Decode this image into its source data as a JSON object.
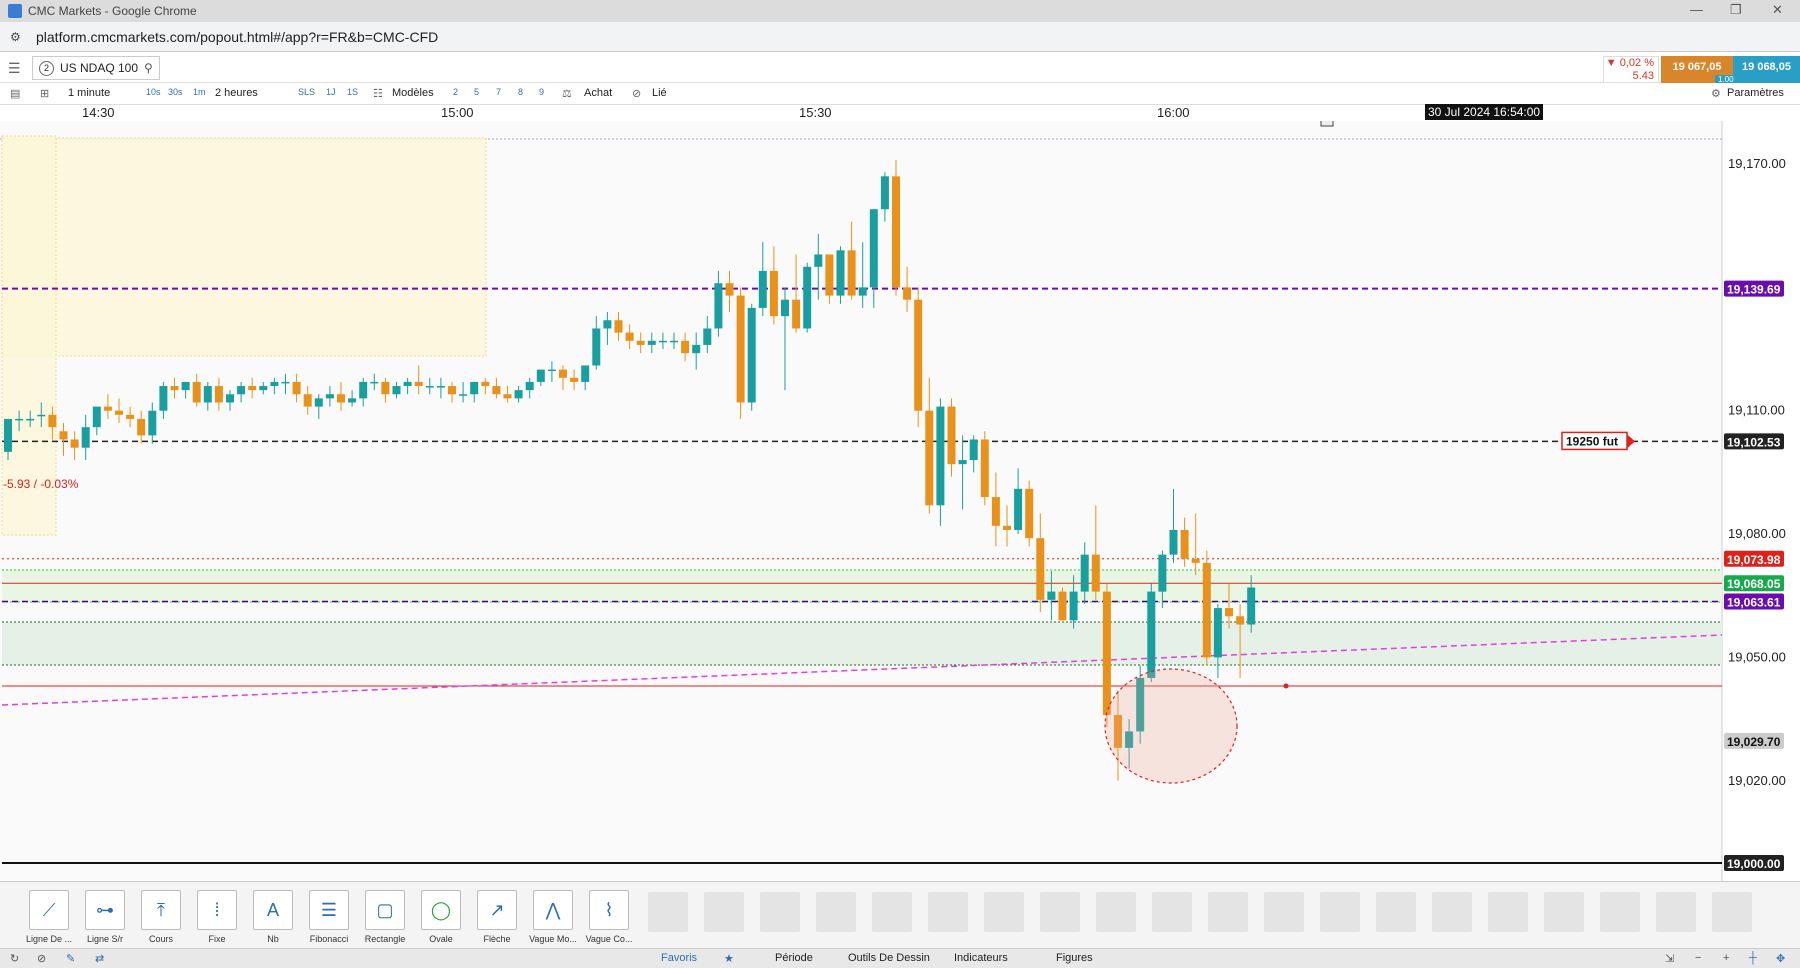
{
  "window": {
    "title": "CMC Markets - Google Chrome"
  },
  "address": {
    "url": "platform.cmcmarkets.com/popout.html#/app?r=FR&b=CMC-CFD"
  },
  "instrument": {
    "index": "2",
    "name": "US NDAQ 100",
    "change_pct": "▼ 0,02 %",
    "change_abs": "5.43",
    "sell_price": "19 067,05",
    "buy_price": "19 068,05",
    "spread": "1.00"
  },
  "toolbar": {
    "interval": "1 minute",
    "interval_options": [
      "10s",
      "30s",
      "1m"
    ],
    "period": "2 heures",
    "period_options": [
      "SLS",
      "1J",
      "1S"
    ],
    "templates": "Modèles",
    "template_slots": [
      "2",
      "5",
      "7",
      "8",
      "9"
    ],
    "buy": "Achat",
    "linked": "Lié",
    "settings": "Paramètres"
  },
  "time_axis": {
    "labels": [
      "14:30",
      "15:00",
      "15:30",
      "16:00"
    ],
    "crosshair": "30 Jul 2024 16:54:00"
  },
  "chart_data": {
    "type": "candlestick",
    "y_ticks": [
      19170,
      19110,
      19080,
      19050,
      19020
    ],
    "y_tick_labels": [
      "19,170.00",
      "19,110.00",
      "19,080.00",
      "19,050.00",
      "19,020.00"
    ],
    "ylim": [
      18994,
      19200
    ],
    "price_labels": [
      {
        "value": 19139.69,
        "text": "19,139.69",
        "color": "#6a0dad"
      },
      {
        "value": 19102.53,
        "text": "19,102.53",
        "color": "#222222"
      },
      {
        "value": 19073.98,
        "text": "19,073.98",
        "color": "#e0201a"
      },
      {
        "value": 19068.05,
        "text": "19,068.05",
        "color": "#1aa84c"
      },
      {
        "value": 19063.61,
        "text": "19,063.61",
        "color": "#6a0dad"
      },
      {
        "value": 19029.7,
        "text": "19,029.70",
        "color": "#cccccc"
      },
      {
        "value": 19000.0,
        "text": "19,000.00",
        "color": "#222222"
      }
    ],
    "alert_label": "19250 fut",
    "change_label": "-5.93 / -0.03%",
    "candles": [
      {
        "o": 19100,
        "h": 19107,
        "c": 19108,
        "l": 19098
      },
      {
        "o": 19108,
        "h": 19110,
        "c": 19108,
        "l": 19105
      },
      {
        "o": 19108,
        "h": 19110,
        "c": 19108,
        "l": 19106
      },
      {
        "o": 19109,
        "h": 19112,
        "c": 19109,
        "l": 19106
      },
      {
        "o": 19109,
        "h": 19111,
        "c": 19106,
        "l": 19103
      },
      {
        "o": 19105,
        "h": 19107,
        "c": 19103,
        "l": 19099
      },
      {
        "o": 19103,
        "h": 19105,
        "c": 19101,
        "l": 19098
      },
      {
        "o": 19101,
        "h": 19109,
        "c": 19106,
        "l": 19098
      },
      {
        "o": 19106,
        "h": 19110,
        "c": 19111,
        "l": 19104
      },
      {
        "o": 19111,
        "h": 19114,
        "c": 19110,
        "l": 19108
      },
      {
        "o": 19110,
        "h": 19113,
        "c": 19109,
        "l": 19107
      },
      {
        "o": 19109,
        "h": 19111,
        "c": 19108,
        "l": 19106
      },
      {
        "o": 19108,
        "h": 19110,
        "c": 19104,
        "l": 19102
      },
      {
        "o": 19104,
        "h": 19112,
        "c": 19110,
        "l": 19102
      },
      {
        "o": 19110,
        "h": 19117,
        "c": 19116,
        "l": 19108
      },
      {
        "o": 19116,
        "h": 19118,
        "c": 19115,
        "l": 19113
      },
      {
        "o": 19115,
        "h": 19117,
        "c": 19117,
        "l": 19113
      },
      {
        "o": 19117,
        "h": 19119,
        "c": 19112,
        "l": 19111
      },
      {
        "o": 19112,
        "h": 19117,
        "c": 19116,
        "l": 19110
      },
      {
        "o": 19116,
        "h": 19118,
        "c": 19112,
        "l": 19110
      },
      {
        "o": 19112,
        "h": 19115,
        "c": 19114,
        "l": 19110
      },
      {
        "o": 19114,
        "h": 19117,
        "c": 19116,
        "l": 19112
      },
      {
        "o": 19116,
        "h": 19118,
        "c": 19115,
        "l": 19113
      },
      {
        "o": 19115,
        "h": 19117,
        "c": 19116,
        "l": 19114
      },
      {
        "o": 19116,
        "h": 19118,
        "c": 19117,
        "l": 19114
      },
      {
        "o": 19117,
        "h": 19119,
        "c": 19117,
        "l": 19114
      },
      {
        "o": 19117,
        "h": 19119,
        "c": 19114,
        "l": 19112
      },
      {
        "o": 19114,
        "h": 19116,
        "c": 19111,
        "l": 19109
      },
      {
        "o": 19111,
        "h": 19114,
        "c": 19113,
        "l": 19108
      },
      {
        "o": 19113,
        "h": 19116,
        "c": 19114,
        "l": 19111
      },
      {
        "o": 19114,
        "h": 19117,
        "c": 19112,
        "l": 19110
      },
      {
        "o": 19112,
        "h": 19115,
        "c": 19113,
        "l": 19111
      },
      {
        "o": 19113,
        "h": 19118,
        "c": 19117,
        "l": 19111
      },
      {
        "o": 19117,
        "h": 19119,
        "c": 19117,
        "l": 19115
      },
      {
        "o": 19117,
        "h": 19118,
        "c": 19114,
        "l": 19112
      },
      {
        "o": 19114,
        "h": 19117,
        "c": 19116,
        "l": 19113
      },
      {
        "o": 19116,
        "h": 19118,
        "c": 19117,
        "l": 19114
      },
      {
        "o": 19117,
        "h": 19121,
        "c": 19116,
        "l": 19114
      },
      {
        "o": 19116,
        "h": 19118,
        "c": 19116,
        "l": 19114
      },
      {
        "o": 19116,
        "h": 19118,
        "c": 19116,
        "l": 19113
      },
      {
        "o": 19116,
        "h": 19117,
        "c": 19114,
        "l": 19112
      },
      {
        "o": 19114,
        "h": 19117,
        "c": 19114,
        "l": 19112
      },
      {
        "o": 19114,
        "h": 19117,
        "c": 19117,
        "l": 19112
      },
      {
        "o": 19117,
        "h": 19118,
        "c": 19116,
        "l": 19114
      },
      {
        "o": 19116,
        "h": 19118,
        "c": 19114,
        "l": 19113
      },
      {
        "o": 19114,
        "h": 19116,
        "c": 19113,
        "l": 19112
      },
      {
        "o": 19113,
        "h": 19116,
        "c": 19115,
        "l": 19112
      },
      {
        "o": 19115,
        "h": 19118,
        "c": 19117,
        "l": 19113
      },
      {
        "o": 19117,
        "h": 19120,
        "c": 19120,
        "l": 19116
      },
      {
        "o": 19120,
        "h": 19122,
        "c": 19120,
        "l": 19117
      },
      {
        "o": 19120,
        "h": 19121,
        "c": 19118,
        "l": 19115
      },
      {
        "o": 19118,
        "h": 19120,
        "c": 19117,
        "l": 19115
      },
      {
        "o": 19117,
        "h": 19121,
        "c": 19121,
        "l": 19115
      },
      {
        "o": 19121,
        "h": 19133,
        "c": 19130,
        "l": 19120
      },
      {
        "o": 19130,
        "h": 19134,
        "c": 19132,
        "l": 19126
      },
      {
        "o": 19132,
        "h": 19134,
        "c": 19129,
        "l": 19127
      },
      {
        "o": 19129,
        "h": 19131,
        "c": 19127,
        "l": 19125
      },
      {
        "o": 19127,
        "h": 19129,
        "c": 19126,
        "l": 19124
      },
      {
        "o": 19126,
        "h": 19129,
        "c": 19127,
        "l": 19124
      },
      {
        "o": 19127,
        "h": 19129,
        "c": 19127,
        "l": 19125
      },
      {
        "o": 19127,
        "h": 19129,
        "c": 19127,
        "l": 19125
      },
      {
        "o": 19127,
        "h": 19129,
        "c": 19124,
        "l": 19122
      },
      {
        "o": 19124,
        "h": 19129,
        "c": 19126,
        "l": 19120
      },
      {
        "o": 19126,
        "h": 19133,
        "c": 19130,
        "l": 19124
      },
      {
        "o": 19130,
        "h": 19144,
        "c": 19141,
        "l": 19128
      },
      {
        "o": 19141,
        "h": 19144,
        "c": 19138,
        "l": 19134
      },
      {
        "o": 19138,
        "h": 19140,
        "c": 19112,
        "l": 19108
      },
      {
        "o": 19112,
        "h": 19136,
        "c": 19135,
        "l": 19110
      },
      {
        "o": 19135,
        "h": 19151,
        "c": 19144,
        "l": 19133
      },
      {
        "o": 19144,
        "h": 19150,
        "c": 19133,
        "l": 19131
      },
      {
        "o": 19133,
        "h": 19140,
        "c": 19137,
        "l": 19115
      },
      {
        "o": 19137,
        "h": 19148,
        "c": 19130,
        "l": 19129
      },
      {
        "o": 19130,
        "h": 19146,
        "c": 19145,
        "l": 19129
      },
      {
        "o": 19145,
        "h": 19153,
        "c": 19148,
        "l": 19137
      },
      {
        "o": 19148,
        "h": 19148,
        "c": 19138,
        "l": 19136
      },
      {
        "o": 19138,
        "h": 19150,
        "c": 19149,
        "l": 19136
      },
      {
        "o": 19149,
        "h": 19156,
        "c": 19138,
        "l": 19137
      },
      {
        "o": 19138,
        "h": 19151,
        "c": 19140,
        "l": 19135
      },
      {
        "o": 19140,
        "h": 19159,
        "c": 19159,
        "l": 19135
      },
      {
        "o": 19159,
        "h": 19168,
        "c": 19167,
        "l": 19156
      },
      {
        "o": 19167,
        "h": 19171,
        "c": 19140,
        "l": 19138
      },
      {
        "o": 19140,
        "h": 19145,
        "c": 19137,
        "l": 19134
      },
      {
        "o": 19137,
        "h": 19140,
        "c": 19110,
        "l": 19106
      },
      {
        "o": 19110,
        "h": 19118,
        "c": 19087,
        "l": 19085
      },
      {
        "o": 19087,
        "h": 19113,
        "c": 19111,
        "l": 19082
      },
      {
        "o": 19111,
        "h": 19113,
        "c": 19097,
        "l": 19094
      },
      {
        "o": 19097,
        "h": 19104,
        "c": 19098,
        "l": 19086
      },
      {
        "o": 19098,
        "h": 19104,
        "c": 19103,
        "l": 19095
      },
      {
        "o": 19103,
        "h": 19105,
        "c": 19089,
        "l": 19087
      },
      {
        "o": 19089,
        "h": 19095,
        "c": 19082,
        "l": 19077
      },
      {
        "o": 19082,
        "h": 19087,
        "c": 19081,
        "l": 19077
      },
      {
        "o": 19081,
        "h": 19096,
        "c": 19091,
        "l": 19080
      },
      {
        "o": 19091,
        "h": 19093,
        "c": 19079,
        "l": 19077
      },
      {
        "o": 19079,
        "h": 19085,
        "c": 19064,
        "l": 19061
      },
      {
        "o": 19064,
        "h": 19071,
        "c": 19066,
        "l": 19059
      },
      {
        "o": 19066,
        "h": 19067,
        "c": 19059,
        "l": 19059
      },
      {
        "o": 19059,
        "h": 19070,
        "c": 19066,
        "l": 19057
      },
      {
        "o": 19066,
        "h": 19078,
        "c": 19075,
        "l": 19063
      },
      {
        "o": 19075,
        "h": 19087,
        "c": 19066,
        "l": 19064
      },
      {
        "o": 19066,
        "h": 19068,
        "c": 19036,
        "l": 19033
      },
      {
        "o": 19036,
        "h": 19042,
        "c": 19028,
        "l": 19020
      },
      {
        "o": 19028,
        "h": 19035,
        "c": 19032,
        "l": 19023
      },
      {
        "o": 19032,
        "h": 19048,
        "c": 19045,
        "l": 19029
      },
      {
        "o": 19045,
        "h": 19068,
        "c": 19066,
        "l": 19044
      },
      {
        "o": 19066,
        "h": 19076,
        "c": 19075,
        "l": 19062
      },
      {
        "o": 19075,
        "h": 19091,
        "c": 19081,
        "l": 19073
      },
      {
        "o": 19081,
        "h": 19084,
        "c": 19074,
        "l": 19072
      },
      {
        "o": 19074,
        "h": 19085,
        "c": 19073,
        "l": 19070
      },
      {
        "o": 19073,
        "h": 19076,
        "c": 19050,
        "l": 19048
      },
      {
        "o": 19050,
        "h": 19063,
        "c": 19062,
        "l": 19045
      },
      {
        "o": 19062,
        "h": 19068,
        "c": 19060,
        "l": 19057
      },
      {
        "o": 19060,
        "h": 19063,
        "c": 19058,
        "l": 19045
      },
      {
        "o": 19058,
        "h": 19070,
        "c": 19067,
        "l": 19056
      }
    ]
  },
  "tools": [
    {
      "label": "Ligne De ...",
      "icon": "line-icon"
    },
    {
      "label": "Ligne S/r",
      "icon": "support-resistance-icon"
    },
    {
      "label": "Cours",
      "icon": "price-line-icon"
    },
    {
      "label": "Fixe",
      "icon": "fixed-line-icon"
    },
    {
      "label": "Nb",
      "icon": "text-icon"
    },
    {
      "label": "Fibonacci",
      "icon": "fibonacci-icon"
    },
    {
      "label": "Rectangle",
      "icon": "rectangle-icon"
    },
    {
      "label": "Ovale",
      "icon": "oval-icon"
    },
    {
      "label": "Flèche",
      "icon": "arrow-icon"
    },
    {
      "label": "Vague Mo...",
      "icon": "wave-icon"
    },
    {
      "label": "Vague Co...",
      "icon": "corrective-wave-icon"
    }
  ],
  "bottom_tabs": {
    "favorites": "Favoris",
    "period": "Période",
    "drawing_tools": "Outils De Dessin",
    "indicators": "Indicateurs",
    "figures": "Figures"
  },
  "colors": {
    "bull": "#1a9fa0",
    "bear": "#e8921c",
    "purple_line": "#6a0dad",
    "red_line": "#e0201a",
    "accent": "#2a6fb5"
  }
}
